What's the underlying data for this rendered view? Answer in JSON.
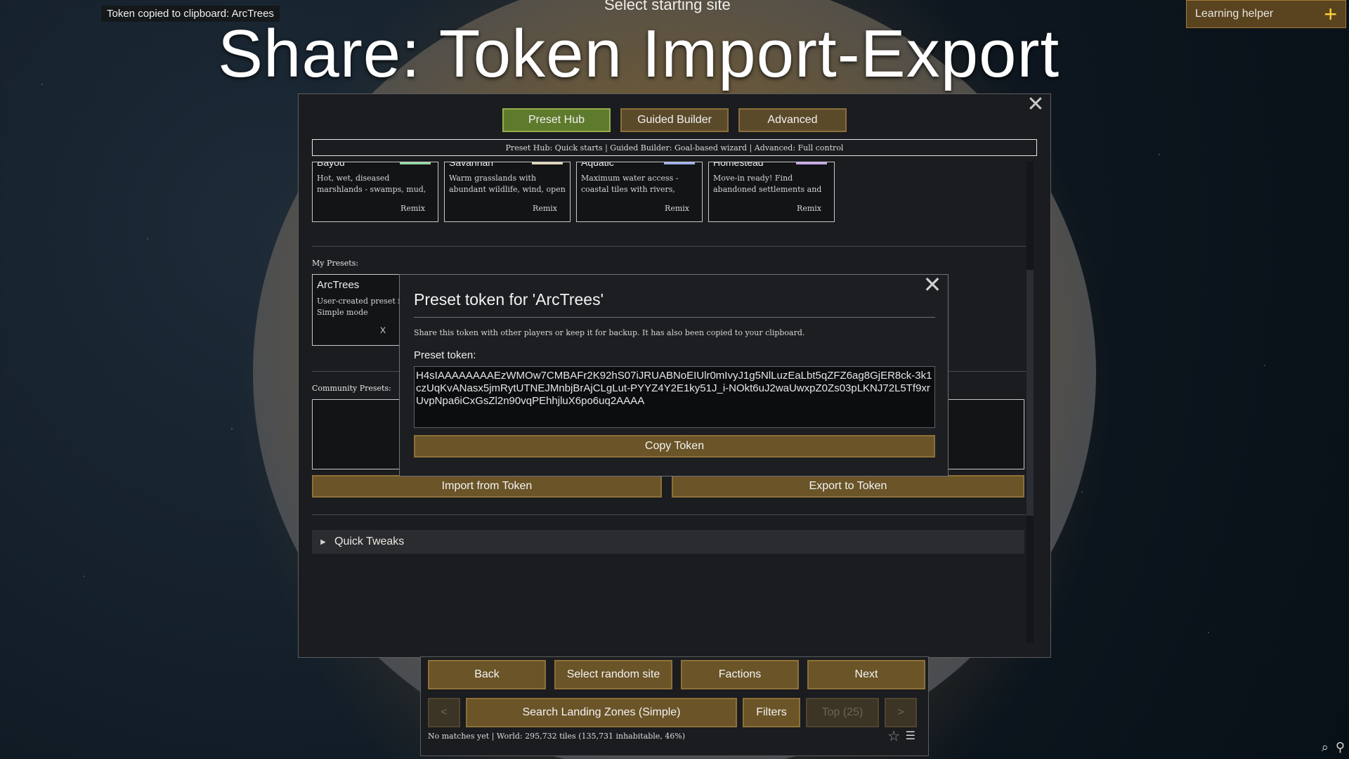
{
  "toast": "Token copied to clipboard: ArcTrees",
  "map_title": "Select starting site",
  "overlay_title": "Share: Token Import-Export",
  "learning_helper": {
    "label": "Learning helper",
    "icon": "plus-icon"
  },
  "window": {
    "tabs": [
      {
        "label": "Preset Hub",
        "active": true
      },
      {
        "label": "Guided Builder",
        "active": false
      },
      {
        "label": "Advanced",
        "active": false
      }
    ],
    "tab_hint": "Preset Hub: Quick starts | Guided Builder: Goal-based wizard | Advanced: Full control",
    "presets": [
      {
        "name": "Bayou",
        "desc": "Hot, wet, diseased marshlands - swamps, mud,",
        "remix": "Remix",
        "color": "#8fd6a2"
      },
      {
        "name": "Savannah",
        "desc": "Warm grasslands with abundant wildlife, wind, open",
        "remix": "Remix",
        "color": "#e0d6b8"
      },
      {
        "name": "Aquatic",
        "desc": "Maximum water access - coastal tiles with rivers,",
        "remix": "Remix",
        "color": "#9aaeea"
      },
      {
        "name": "Homestead",
        "desc": "Move-in ready! Find abandoned settlements and",
        "remix": "Remix",
        "color": "#c7a8ea"
      }
    ],
    "my_presets_label": "My Presets:",
    "my_preset": {
      "name": "ArcTrees",
      "desc_line1": "User-created preset fr",
      "desc_line2": "Simple mode",
      "delete": "X"
    },
    "community_label": "Community Presets:",
    "import_label": "Import from Token",
    "export_label": "Export to Token",
    "quick_tweaks_label": "Quick Tweaks"
  },
  "dialog": {
    "title": "Preset token for 'ArcTrees'",
    "note": "Share this token with other players or keep it for backup. It has also been copied to your clipboard.",
    "token_label": "Preset token:",
    "token": "H4sIAAAAAAAAEzWMOw7CMBAFr2K92hS07iJRUABNoEIUlr0mIvyJ1g5NlLuzEaLbt5qZFZ6ag8GjER8ck-3k1czUqKvANasx5jmRytUTNEJMnbjBrAjCLgLut-PYYZ4Y2E1ky51J_i-NOkt6uJ2waUwxpZ0Zs03pLKNJ72L5Tf9xrUvpNpa6iCxGsZl2n90vqPEhhjluX6po6uq2AAAA",
    "copy_label": "Copy Token"
  },
  "bottom": {
    "back": "Back",
    "random": "Select random site",
    "factions": "Factions",
    "next": "Next",
    "prev_page": "<",
    "search": "Search Landing Zones (Simple)",
    "filters": "Filters",
    "top": "Top (25)",
    "next_page": ">",
    "status": "No matches yet | World: 295,732 tiles (135,731 inhabitable, 46%)"
  }
}
